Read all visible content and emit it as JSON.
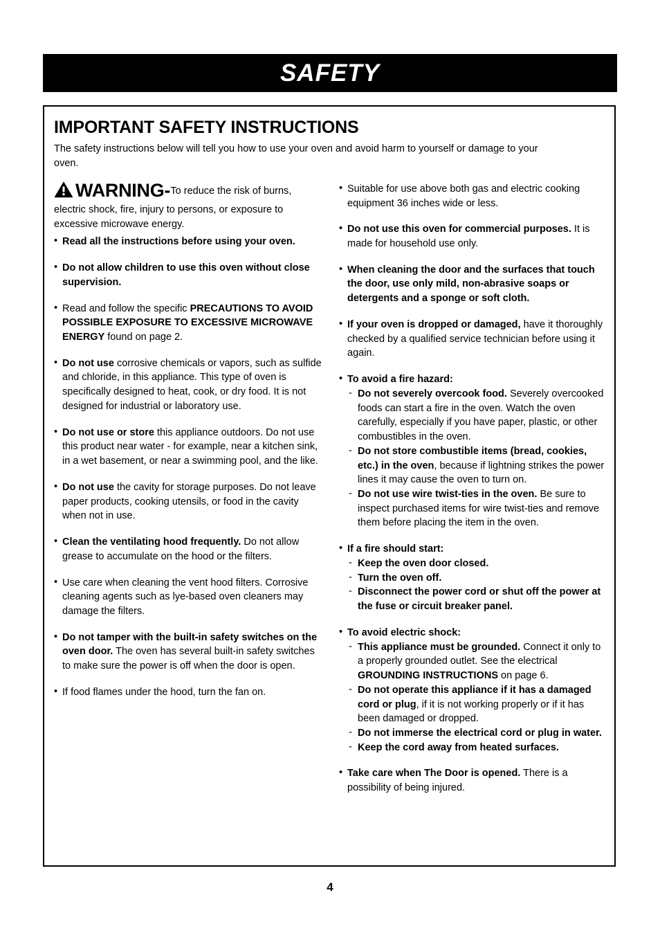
{
  "header": {
    "title": "SAFETY"
  },
  "section": {
    "title": "IMPORTANT SAFETY INSTRUCTIONS",
    "intro": "The safety instructions below will tell you how to use your oven and avoid harm to yourself or damage to your oven."
  },
  "warning": {
    "icon": "warning-triangle-icon",
    "word": "WARNING",
    "dash": "-",
    "lead": "To reduce the risk of burns,",
    "rest": "electric shock, fire, injury to persons, or exposure to excessive microwave energy."
  },
  "left_column": {
    "bullet_marker": "•",
    "items": [
      {
        "id": "read-all-instructions",
        "parts": [
          {
            "text": "Read all the instructions before using your oven.",
            "bold": true
          }
        ]
      },
      {
        "id": "children-supervision",
        "parts": [
          {
            "text": "Do not allow children to use this oven without close supervision.",
            "bold": true
          }
        ]
      },
      {
        "id": "precautions-reference",
        "parts": [
          {
            "text": "Read and follow the specific ",
            "bold": false
          },
          {
            "text": "PRECAUTIONS TO AVOID POSSIBLE EXPOSURE TO EXCESSIVE MICROWAVE ENERGY",
            "bold": true
          },
          {
            "text": " found on page 2.",
            "bold": false
          }
        ]
      },
      {
        "id": "no-corrosive-chemicals",
        "parts": [
          {
            "text": "Do not use",
            "bold": true
          },
          {
            "text": " corrosive chemicals or vapors, such as sulfide and chloride, in this appliance. This type of oven is specifically designed to heat, cook, or dry food. It is not designed for industrial or laboratory use.",
            "bold": false
          }
        ]
      },
      {
        "id": "no-outdoor-use",
        "parts": [
          {
            "text": "Do not use or store",
            "bold": true
          },
          {
            "text": " this appliance outdoors. Do not use this product near water - for example, near a kitchen sink, in a wet basement, or near a swimming pool, and the like.",
            "bold": false
          }
        ]
      },
      {
        "id": "no-cavity-storage",
        "parts": [
          {
            "text": "Do not use",
            "bold": true
          },
          {
            "text": " the cavity for storage purposes. Do not leave paper products, cooking utensils, or food in the cavity when not in use.",
            "bold": false
          }
        ]
      },
      {
        "id": "clean-ventilating-hood",
        "parts": [
          {
            "text": "Clean the ventilating hood frequently.",
            "bold": true
          },
          {
            "text": " Do not allow grease to accumulate on the hood or the filters.",
            "bold": false
          }
        ]
      },
      {
        "id": "vent-hood-filter-care",
        "parts": [
          {
            "text": "Use care when cleaning the vent hood filters. Corrosive cleaning agents such as lye-based oven cleaners may damage the filters.",
            "bold": false
          }
        ]
      },
      {
        "id": "no-tamper-safety-switches",
        "parts": [
          {
            "text": "Do not tamper with the built-in safety switches on the oven door.",
            "bold": true
          },
          {
            "text": " The oven has several built-in safety switches to make sure the power is off when the door is open.",
            "bold": false
          }
        ]
      },
      {
        "id": "food-flames-fan",
        "parts": [
          {
            "text": "If food flames under the hood, turn the fan on.",
            "bold": false
          }
        ]
      }
    ]
  },
  "right_column": {
    "bullet_marker": "•",
    "dash_marker": "-",
    "items": [
      {
        "id": "suitable-above-cooking-equipment",
        "parts": [
          {
            "text": "Suitable for use above both gas and electric cooking equipment 36 inches wide or less.",
            "bold": false
          }
        ]
      },
      {
        "id": "no-commercial-use",
        "parts": [
          {
            "text": "Do not use this oven for commercial purposes.",
            "bold": true
          },
          {
            "text": " It is made for household use only.",
            "bold": false
          }
        ]
      },
      {
        "id": "door-cleaning-instructions",
        "parts": [
          {
            "text": "When cleaning the door and the surfaces that touch the door, use only mild, non-abrasive soaps or detergents and a sponge or soft cloth.",
            "bold": true
          }
        ]
      },
      {
        "id": "oven-dropped-or-damaged",
        "parts": [
          {
            "text": "If your oven is dropped or damaged,",
            "bold": true
          },
          {
            "text": " have it thoroughly checked by a qualified service technician before using it again.",
            "bold": false
          }
        ]
      },
      {
        "id": "avoid-fire-hazard",
        "parts": [
          {
            "text": "To avoid a fire hazard:",
            "bold": true
          }
        ],
        "subs": [
          {
            "id": "no-severe-overcook",
            "parts": [
              {
                "text": "Do not severely overcook food.",
                "bold": true
              },
              {
                "text": " Severely overcooked foods can start a fire in the oven. Watch the oven carefully, especially if you have paper, plastic, or other combustibles in the oven.",
                "bold": false
              }
            ]
          },
          {
            "id": "no-combustible-storage",
            "parts": [
              {
                "text": "Do not store combustible items (bread, cookies, etc.) in the oven",
                "bold": true
              },
              {
                "text": ", because if lightning strikes the power lines it may cause the oven to turn on.",
                "bold": false
              }
            ]
          },
          {
            "id": "no-wire-twist-ties",
            "parts": [
              {
                "text": "Do not use wire twist-ties in the oven.",
                "bold": true
              },
              {
                "text": " Be sure to inspect purchased items for wire twist-ties and remove them before placing the item in the oven.",
                "bold": false
              }
            ]
          }
        ]
      },
      {
        "id": "if-fire-should-start",
        "parts": [
          {
            "text": "If a fire should start:",
            "bold": true
          }
        ],
        "subs": [
          {
            "id": "keep-door-closed",
            "parts": [
              {
                "text": "Keep the oven door closed.",
                "bold": true
              }
            ]
          },
          {
            "id": "turn-oven-off",
            "parts": [
              {
                "text": "Turn the oven off.",
                "bold": true
              }
            ]
          },
          {
            "id": "disconnect-power",
            "parts": [
              {
                "text": "Disconnect the power cord or shut off the power at the fuse or circuit breaker panel.",
                "bold": true
              }
            ]
          }
        ]
      },
      {
        "id": "avoid-electric-shock",
        "parts": [
          {
            "text": "To avoid electric shock:",
            "bold": true
          }
        ],
        "subs": [
          {
            "id": "appliance-must-be-grounded",
            "parts": [
              {
                "text": "This appliance must be grounded.",
                "bold": true
              },
              {
                "text": " Connect it only to a properly grounded outlet. See the electrical ",
                "bold": false
              },
              {
                "text": "GROUNDING INSTRUCTIONS",
                "bold": true
              },
              {
                "text": " on page 6.",
                "bold": false
              }
            ]
          },
          {
            "id": "no-damaged-cord-or-plug",
            "parts": [
              {
                "text": "Do not operate this appliance if it has a damaged cord or plug",
                "bold": true
              },
              {
                "text": ", if it is not working properly or if it has been damaged or dropped.",
                "bold": false
              }
            ]
          },
          {
            "id": "no-immerse-cord",
            "parts": [
              {
                "text": "Do not immerse the electrical cord or plug in water.",
                "bold": true
              }
            ]
          },
          {
            "id": "keep-cord-away-from-heat",
            "parts": [
              {
                "text": "Keep the cord away from heated surfaces.",
                "bold": true
              }
            ]
          }
        ]
      },
      {
        "id": "take-care-door-opened",
        "parts": [
          {
            "text": "Take care when The Door is opened.",
            "bold": true
          },
          {
            "text": " There is a possibility of being injured.",
            "bold": false
          }
        ]
      }
    ]
  },
  "footer": {
    "page_number": "4"
  },
  "colors": {
    "banner_background": "#000000",
    "banner_text": "#ffffff",
    "body_text": "#000000",
    "page_background": "#ffffff",
    "border": "#000000"
  }
}
